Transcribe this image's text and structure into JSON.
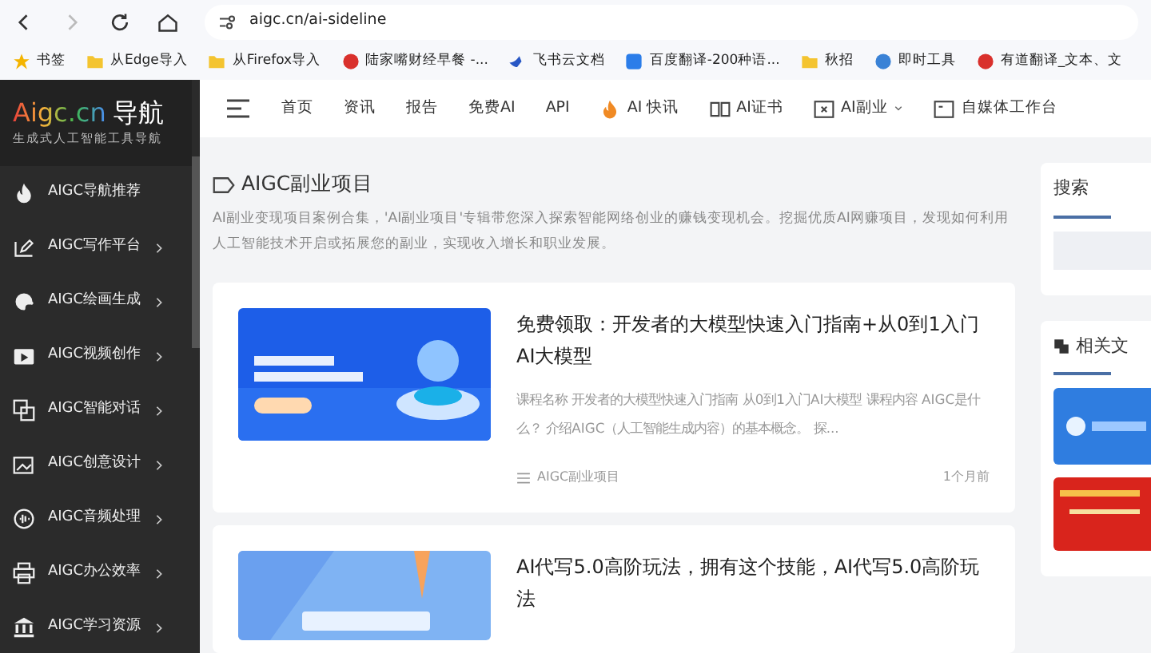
{
  "browser": {
    "url": "aigc.cn/ai-sideline",
    "bookmarks": [
      {
        "label": "书签",
        "kind": "star"
      },
      {
        "label": "从Edge导入",
        "kind": "folder"
      },
      {
        "label": "从Firefox导入",
        "kind": "folder"
      },
      {
        "label": "陆家嘴财经早餐 -...",
        "kind": "red"
      },
      {
        "label": "飞书云文档",
        "kind": "bird"
      },
      {
        "label": "百度翻译-200种语...",
        "kind": "blue"
      },
      {
        "label": "秋招",
        "kind": "folder"
      },
      {
        "label": "即时工具",
        "kind": "tool"
      },
      {
        "label": "有道翻译_文本、文",
        "kind": "red"
      }
    ]
  },
  "logo": {
    "title_a": "Aigc.cn",
    "title_b": "导航",
    "subtitle": "生成式人工智能工具导航"
  },
  "sidebar": {
    "items": [
      {
        "label": "AIGC导航推荐",
        "has_submenu": false
      },
      {
        "label": "AIGC写作平台",
        "has_submenu": true
      },
      {
        "label": "AIGC绘画生成",
        "has_submenu": true
      },
      {
        "label": "AIGC视频创作",
        "has_submenu": true
      },
      {
        "label": "AIGC智能对话",
        "has_submenu": true
      },
      {
        "label": "AIGC创意设计",
        "has_submenu": true
      },
      {
        "label": "AIGC音频处理",
        "has_submenu": true
      },
      {
        "label": "AIGC办公效率",
        "has_submenu": true
      },
      {
        "label": "AIGC学习资源",
        "has_submenu": true
      }
    ]
  },
  "nav": {
    "items": [
      {
        "label": "首页",
        "dropdown": false
      },
      {
        "label": "资讯",
        "dropdown": false
      },
      {
        "label": "报告",
        "dropdown": false
      },
      {
        "label": "免费AI",
        "dropdown": false
      },
      {
        "label": "API",
        "dropdown": false
      },
      {
        "label": "AI 快讯",
        "dropdown": false
      },
      {
        "label": "AI证书",
        "dropdown": false
      },
      {
        "label": "AI副业",
        "dropdown": true
      },
      {
        "label": "自媒体工作台",
        "dropdown": false
      }
    ]
  },
  "page": {
    "title": "AIGC副业项目",
    "description": "AI副业变现项目案例合集，'AI副业项目'专辑带您深入探索智能网络创业的赚钱变现机会。挖掘优质AI网赚项目，发现如何利用人工智能技术开启或拓展您的副业，实现收入增长和职业发展。"
  },
  "posts": [
    {
      "title": "免费领取：开发者的大模型快速入门指南+从0到1入门AI大模型",
      "excerpt": "课程名称 开发者的大模型快速入门指南 从0到1入门AI大模型 课程内容 AIGC是什么？ 介绍AIGC（人工智能生成内容）的基本概念。 探...",
      "category": "AIGC副业项目",
      "time": "1个月前",
      "kind": "picture"
    },
    {
      "title": "AI代写5.0高阶玩法，拥有这个技能，AI代写5.0高阶玩法",
      "kind": "picture"
    }
  ],
  "widgets": [
    {
      "title": "搜索"
    },
    {
      "title": "相关文"
    }
  ]
}
